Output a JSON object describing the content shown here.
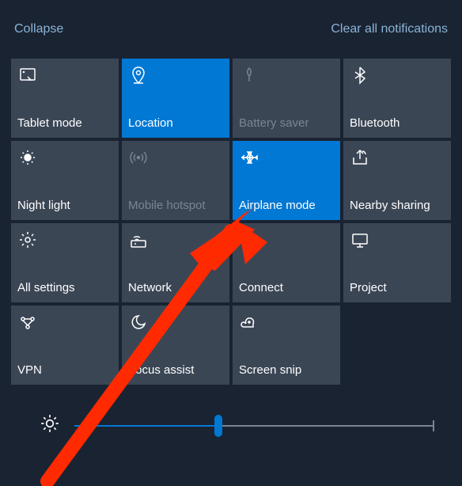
{
  "links": {
    "collapse": "Collapse",
    "clear": "Clear all notifications"
  },
  "tiles": [
    {
      "id": "tablet-mode",
      "label": "Tablet mode",
      "icon": "tablet",
      "state": "normal"
    },
    {
      "id": "location",
      "label": "Location",
      "icon": "location",
      "state": "active"
    },
    {
      "id": "battery-saver",
      "label": "Battery saver",
      "icon": "battery",
      "state": "disabled"
    },
    {
      "id": "bluetooth",
      "label": "Bluetooth",
      "icon": "bluetooth",
      "state": "normal"
    },
    {
      "id": "night-light",
      "label": "Night light",
      "icon": "night",
      "state": "normal"
    },
    {
      "id": "mobile-hotspot",
      "label": "Mobile hotspot",
      "icon": "hotspot",
      "state": "disabled"
    },
    {
      "id": "airplane-mode",
      "label": "Airplane mode",
      "icon": "airplane",
      "state": "active"
    },
    {
      "id": "nearby-sharing",
      "label": "Nearby sharing",
      "icon": "share",
      "state": "normal"
    },
    {
      "id": "all-settings",
      "label": "All settings",
      "icon": "settings",
      "state": "normal"
    },
    {
      "id": "network",
      "label": "Network",
      "icon": "network",
      "state": "normal"
    },
    {
      "id": "connect",
      "label": "Connect",
      "icon": "connect",
      "state": "normal"
    },
    {
      "id": "project",
      "label": "Project",
      "icon": "project",
      "state": "normal"
    },
    {
      "id": "vpn",
      "label": "VPN",
      "icon": "vpn",
      "state": "normal"
    },
    {
      "id": "focus-assist",
      "label": "Focus assist",
      "icon": "focus",
      "state": "normal"
    },
    {
      "id": "screen-snip",
      "label": "Screen snip",
      "icon": "snip",
      "state": "normal"
    }
  ],
  "brightness": {
    "value": 40,
    "min": 0,
    "max": 100
  },
  "annotation_arrow": {
    "target_tile": "airplane-mode",
    "color": "#ff2a00"
  }
}
